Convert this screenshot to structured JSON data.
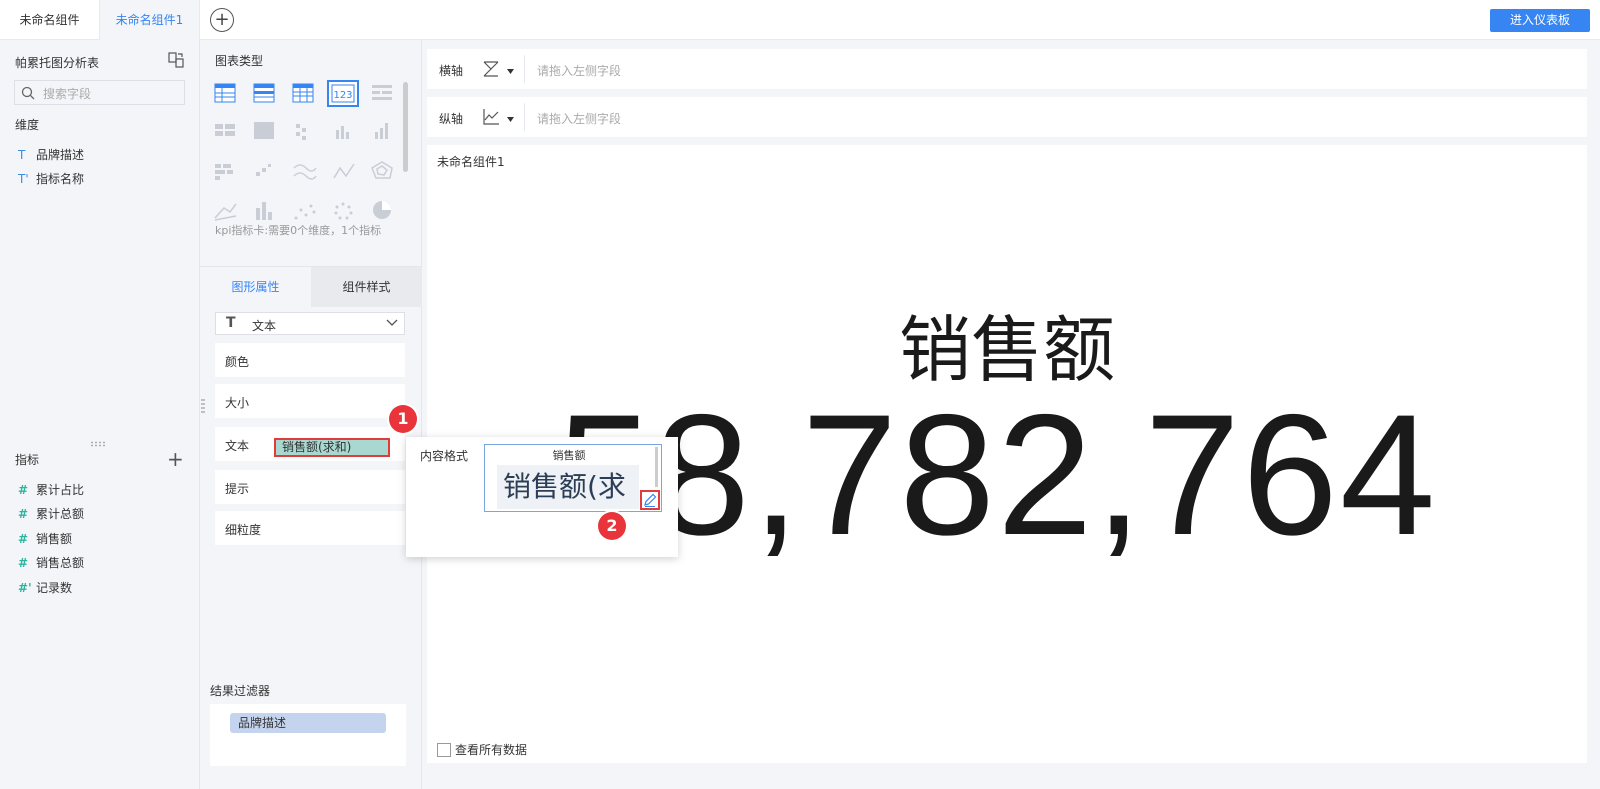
{
  "tabs": [
    "未命名组件",
    "未命名组件1"
  ],
  "add_tab_symbol": "+",
  "enter_dashboard": "进入仪表板",
  "left": {
    "title": "帕累托图分析表",
    "search_placeholder": "搜索字段",
    "dimension_label": "维度",
    "dimensions": [
      {
        "icon": "T",
        "label": "品牌描述"
      },
      {
        "icon": "T'",
        "label": "指标名称"
      }
    ],
    "metric_label": "指标",
    "metric_add": "+",
    "metrics": [
      {
        "icon": "#",
        "label": "累计占比"
      },
      {
        "icon": "#",
        "label": "累计总额"
      },
      {
        "icon": "#",
        "label": "销售额"
      },
      {
        "icon": "#",
        "label": "销售总额"
      },
      {
        "icon": "#'",
        "label": "记录数"
      }
    ]
  },
  "middle": {
    "chart_type_title": "图表类型",
    "kpi_note": "kpi指标卡:需要0个维度，1个指标",
    "kpi_icon_text": "123",
    "prop_tabs": [
      "图形属性",
      "组件样式"
    ],
    "select_value": "文本",
    "rows": [
      "颜色",
      "大小",
      "文本",
      "提示",
      "细粒度"
    ],
    "text_pill": "销售额(求和)",
    "filter_label": "结果过滤器",
    "filter_pill": "品牌描述"
  },
  "main": {
    "x_axis_label": "横轴",
    "y_axis_label": "纵轴",
    "drop_placeholder": "请拖入左侧字段",
    "component_title": "未命名组件1",
    "kpi_name": "销售额",
    "kpi_value": "58,782,764",
    "view_all": "查看所有数据"
  },
  "popup": {
    "label": "内容格式",
    "editor_header": "销售额",
    "editor_text": "销售额(求"
  },
  "badges": [
    "1",
    "2"
  ],
  "colors": {
    "accent": "#3685f2",
    "badge": "#e8343a",
    "pill": "#a8d8cf",
    "filter_pill": "#c4d4ee"
  }
}
